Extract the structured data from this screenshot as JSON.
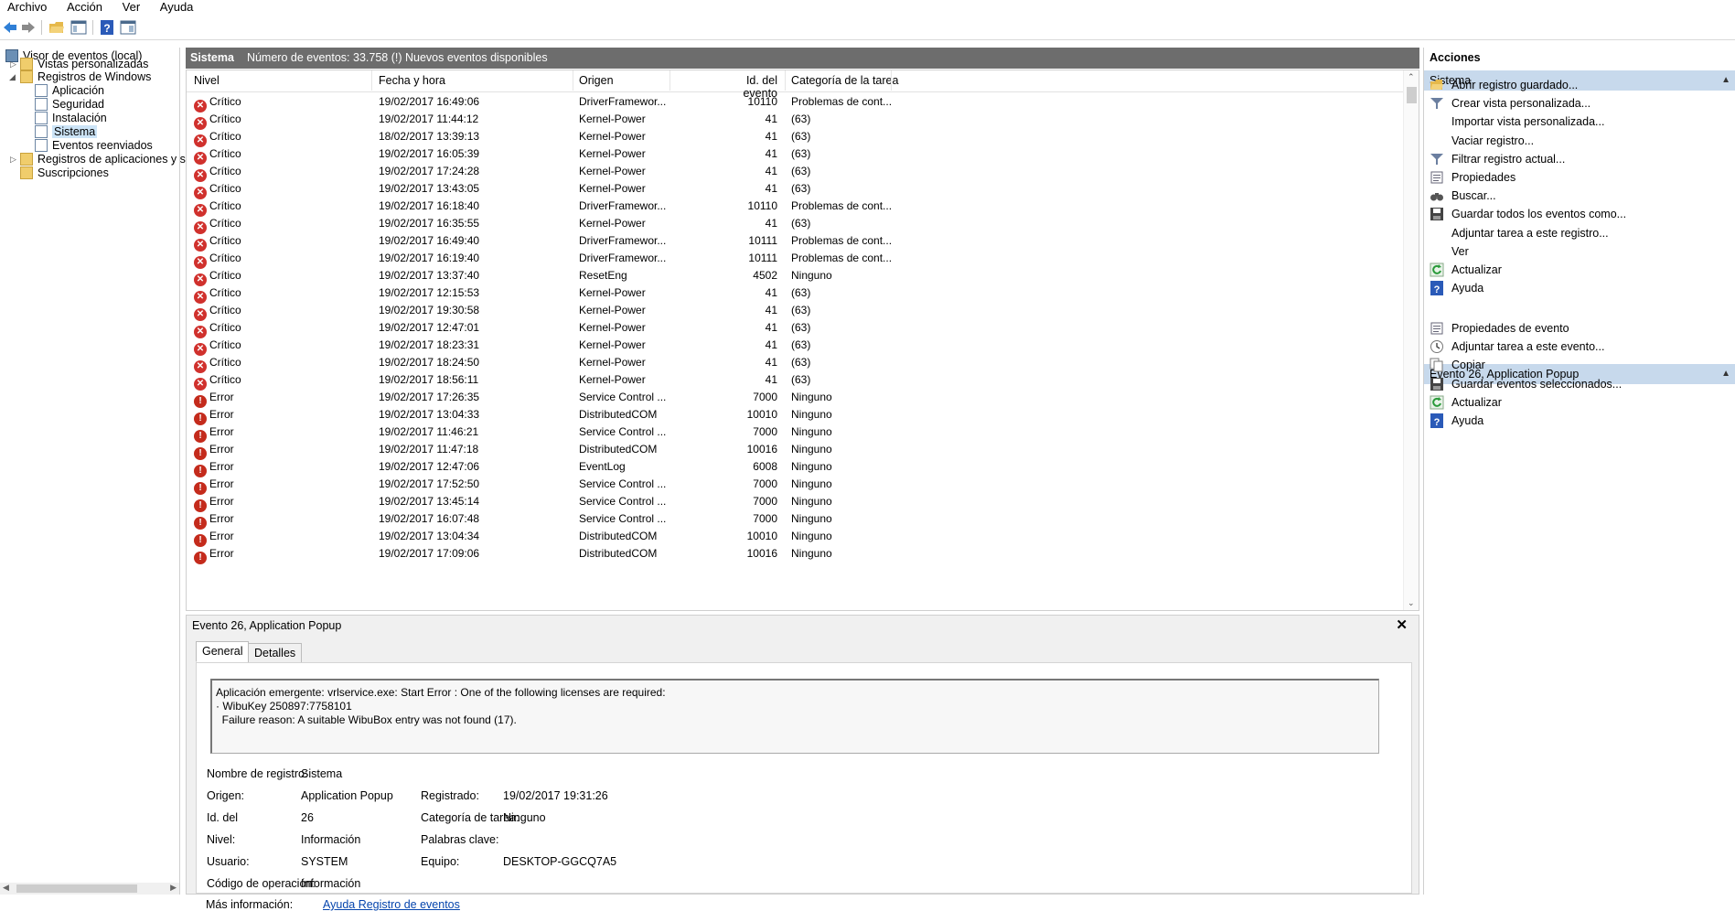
{
  "menu": [
    "Archivo",
    "Acción",
    "Ver",
    "Ayuda"
  ],
  "tree": {
    "root": "Visor de eventos (local)",
    "items": [
      {
        "label": "Vistas personalizadas"
      },
      {
        "label": "Registros de Windows"
      },
      {
        "label": "Aplicación"
      },
      {
        "label": "Seguridad"
      },
      {
        "label": "Instalación"
      },
      {
        "label": "Sistema"
      },
      {
        "label": "Eventos reenviados"
      },
      {
        "label": "Registros de aplicaciones y s"
      },
      {
        "label": "Suscripciones"
      }
    ]
  },
  "center": {
    "title": "Sistema",
    "count_text": "Número de eventos: 33.758 (!) Nuevos eventos disponibles",
    "columns": [
      "Nivel",
      "Fecha y hora",
      "Origen",
      "Id. del evento",
      "Categoría de la tarea"
    ],
    "rows": [
      [
        "Crítico",
        "19/02/2017 16:49:06",
        "DriverFramewor...",
        "10110",
        "Problemas de cont..."
      ],
      [
        "Crítico",
        "19/02/2017 11:44:12",
        "Kernel-Power",
        "41",
        "(63)"
      ],
      [
        "Crítico",
        "18/02/2017 13:39:13",
        "Kernel-Power",
        "41",
        "(63)"
      ],
      [
        "Crítico",
        "19/02/2017 16:05:39",
        "Kernel-Power",
        "41",
        "(63)"
      ],
      [
        "Crítico",
        "19/02/2017 17:24:28",
        "Kernel-Power",
        "41",
        "(63)"
      ],
      [
        "Crítico",
        "19/02/2017 13:43:05",
        "Kernel-Power",
        "41",
        "(63)"
      ],
      [
        "Crítico",
        "19/02/2017 16:18:40",
        "DriverFramewor...",
        "10110",
        "Problemas de cont..."
      ],
      [
        "Crítico",
        "19/02/2017 16:35:55",
        "Kernel-Power",
        "41",
        "(63)"
      ],
      [
        "Crítico",
        "19/02/2017 16:49:40",
        "DriverFramewor...",
        "10111",
        "Problemas de cont..."
      ],
      [
        "Crítico",
        "19/02/2017 16:19:40",
        "DriverFramewor...",
        "10111",
        "Problemas de cont..."
      ],
      [
        "Crítico",
        "19/02/2017 13:37:40",
        "ResetEng",
        "4502",
        "Ninguno"
      ],
      [
        "Crítico",
        "19/02/2017 12:15:53",
        "Kernel-Power",
        "41",
        "(63)"
      ],
      [
        "Crítico",
        "19/02/2017 19:30:58",
        "Kernel-Power",
        "41",
        "(63)"
      ],
      [
        "Crítico",
        "19/02/2017 12:47:01",
        "Kernel-Power",
        "41",
        "(63)"
      ],
      [
        "Crítico",
        "19/02/2017 18:23:31",
        "Kernel-Power",
        "41",
        "(63)"
      ],
      [
        "Crítico",
        "19/02/2017 18:24:50",
        "Kernel-Power",
        "41",
        "(63)"
      ],
      [
        "Crítico",
        "19/02/2017 18:56:11",
        "Kernel-Power",
        "41",
        "(63)"
      ],
      [
        "Error",
        "19/02/2017 17:26:35",
        "Service Control ...",
        "7000",
        "Ninguno"
      ],
      [
        "Error",
        "19/02/2017 13:04:33",
        "DistributedCOM",
        "10010",
        "Ninguno"
      ],
      [
        "Error",
        "19/02/2017 11:46:21",
        "Service Control ...",
        "7000",
        "Ninguno"
      ],
      [
        "Error",
        "19/02/2017 11:47:18",
        "DistributedCOM",
        "10016",
        "Ninguno"
      ],
      [
        "Error",
        "19/02/2017 12:47:06",
        "EventLog",
        "6008",
        "Ninguno"
      ],
      [
        "Error",
        "19/02/2017 17:52:50",
        "Service Control ...",
        "7000",
        "Ninguno"
      ],
      [
        "Error",
        "19/02/2017 13:45:14",
        "Service Control ...",
        "7000",
        "Ninguno"
      ],
      [
        "Error",
        "19/02/2017 16:07:48",
        "Service Control ...",
        "7000",
        "Ninguno"
      ],
      [
        "Error",
        "19/02/2017 13:04:34",
        "DistributedCOM",
        "10010",
        "Ninguno"
      ],
      [
        "Error",
        "19/02/2017 17:09:06",
        "DistributedCOM",
        "10016",
        "Ninguno"
      ]
    ]
  },
  "details": {
    "title": "Evento 26, Application Popup",
    "tabs": [
      "General",
      "Detalles"
    ],
    "message_lines": [
      "Aplicación emergente: vrlservice.exe: Start Error : One of the following licenses are required:",
      "· WibuKey 250897:7758101",
      "  Failure reason: A suitable WibuBox entry was not found (17)."
    ],
    "props": {
      "log_label": "Nombre de registro:",
      "log_value": "Sistema",
      "source_label": "Origen:",
      "source_value": "Application Popup",
      "logged_label": "Registrado:",
      "logged_value": "19/02/2017 19:31:26",
      "id_label": "Id. del",
      "id_value": "26",
      "category_label": "Categoría de tarea:",
      "category_value": "Ninguno",
      "level_label": "Nivel:",
      "level_value": "Información",
      "keywords_label": "Palabras clave:",
      "keywords_value": "",
      "user_label": "Usuario:",
      "user_value": "SYSTEM",
      "computer_label": "Equipo:",
      "computer_value": "DESKTOP-GGCQ7A5",
      "opcode_label": "Código de operación:",
      "opcode_value": "Información",
      "moreinfo_label": "Más información:",
      "moreinfo_link": "Ayuda Registro de eventos"
    }
  },
  "actions": {
    "title": "Acciones",
    "section1": "Sistema",
    "items1": [
      {
        "label": "Abrir registro guardado...",
        "icon": "open-folder-icon"
      },
      {
        "label": "Crear vista personalizada...",
        "icon": "filter-icon"
      },
      {
        "label": "Importar vista personalizada...",
        "icon": ""
      },
      {
        "label": "Vaciar registro...",
        "icon": ""
      },
      {
        "label": "Filtrar registro actual...",
        "icon": "filter-icon"
      },
      {
        "label": "Propiedades",
        "icon": "properties-icon"
      },
      {
        "label": "Buscar...",
        "icon": "binoculars-icon"
      },
      {
        "label": "Guardar todos los eventos como...",
        "icon": "save-icon"
      },
      {
        "label": "Adjuntar tarea a este registro...",
        "icon": ""
      },
      {
        "label": "Ver",
        "icon": ""
      },
      {
        "label": "Actualizar",
        "icon": "refresh-icon"
      },
      {
        "label": "Ayuda",
        "icon": "help-icon"
      }
    ],
    "section2": "Evento 26, Application Popup",
    "items2": [
      {
        "label": "Propiedades de evento",
        "icon": "properties-icon"
      },
      {
        "label": "Adjuntar tarea a este evento...",
        "icon": "task-icon"
      },
      {
        "label": "Copiar",
        "icon": "copy-icon"
      },
      {
        "label": "Guardar eventos seleccionados...",
        "icon": "save-icon"
      },
      {
        "label": "Actualizar",
        "icon": "refresh-icon"
      },
      {
        "label": "Ayuda",
        "icon": "help-icon"
      }
    ]
  },
  "colors": {
    "critical": "#d0312d",
    "error": "#c42b1c",
    "section_bg": "#c7d9ec",
    "header_bg": "#6d6d6d"
  }
}
